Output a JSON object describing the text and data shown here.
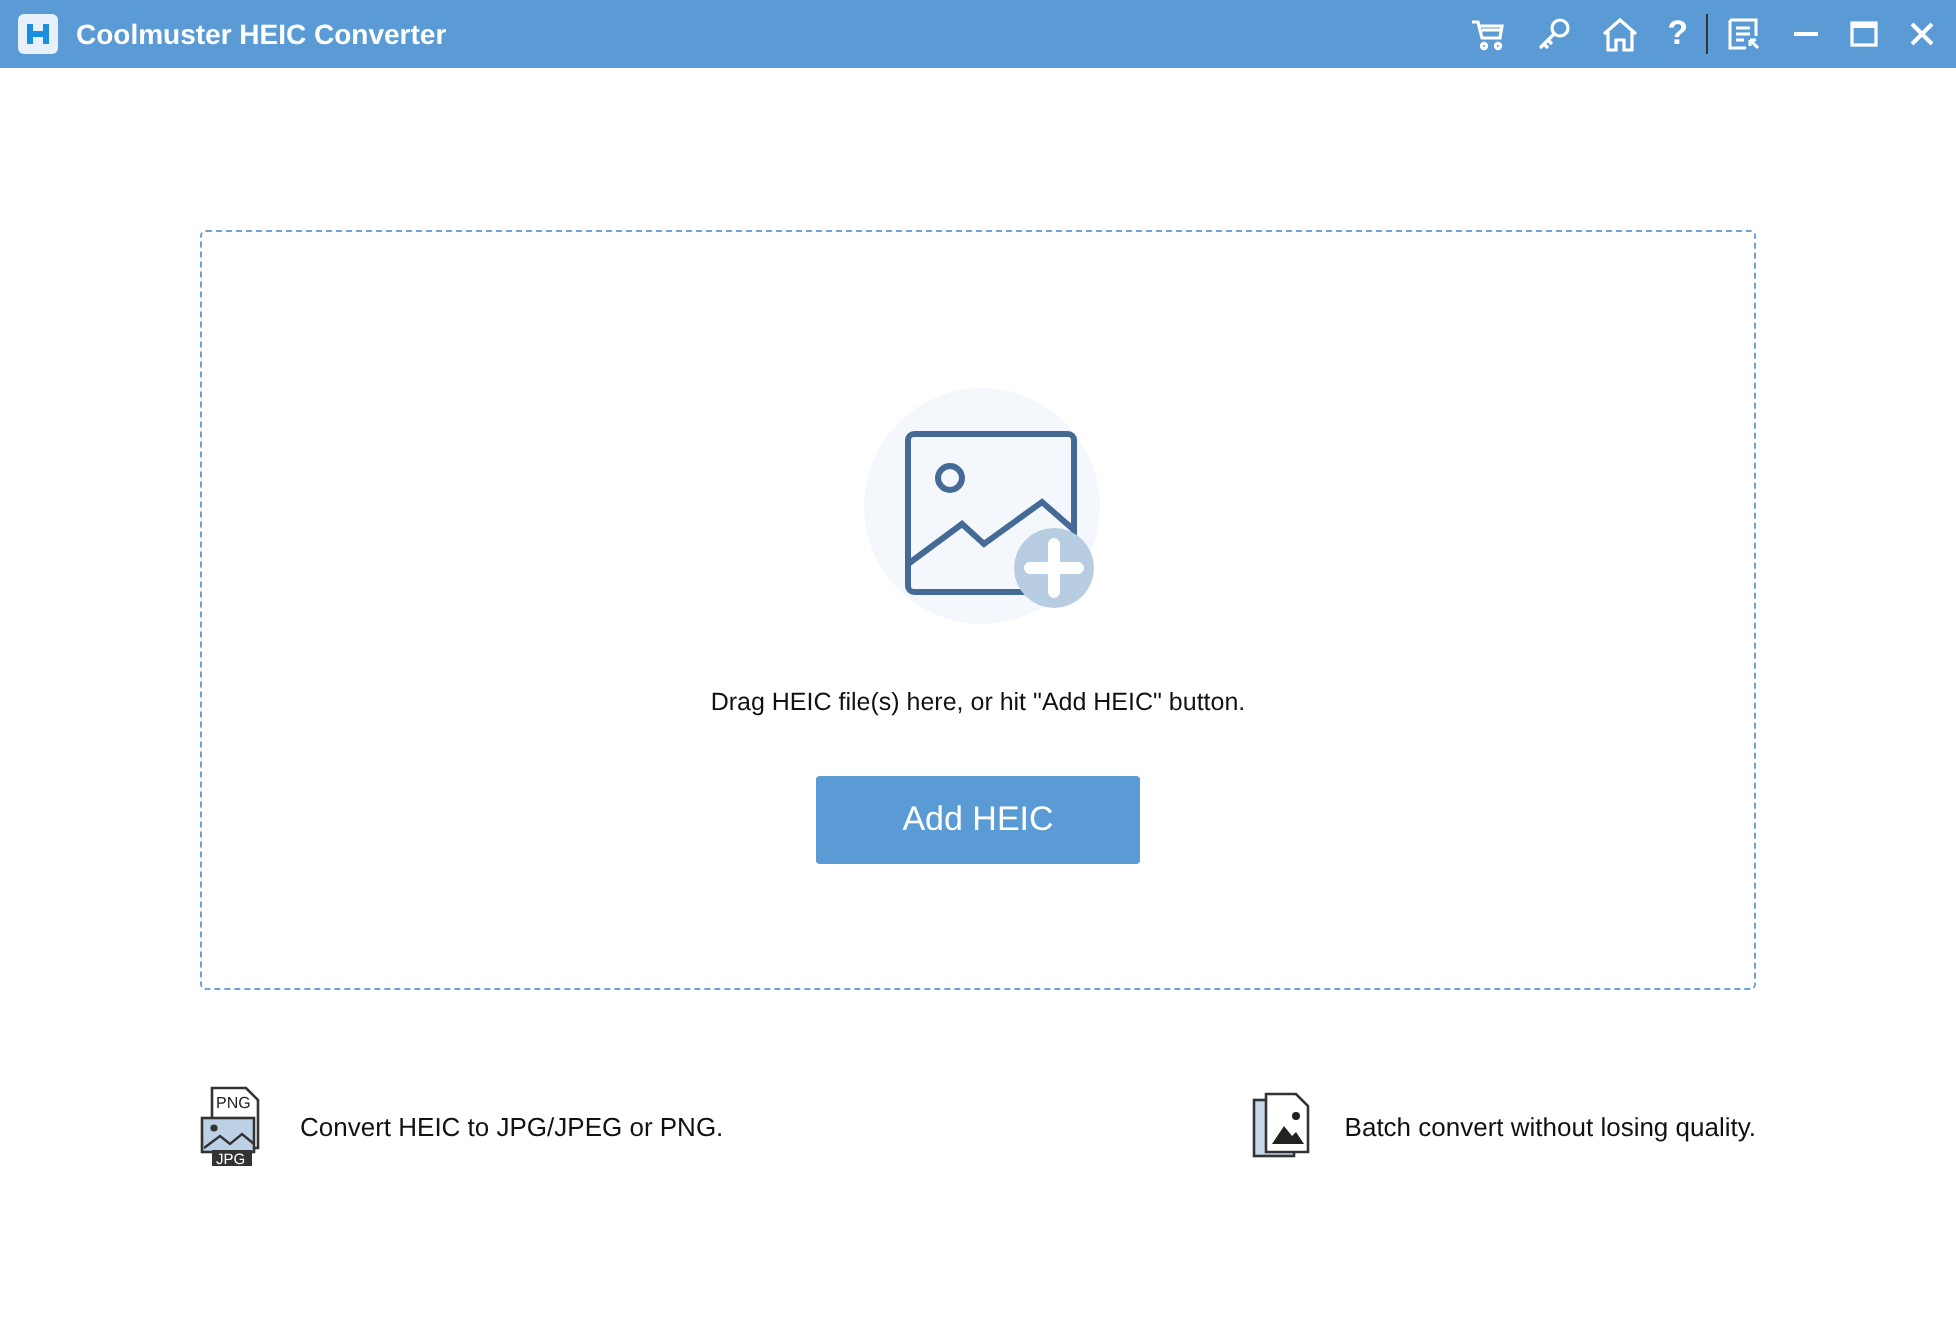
{
  "window": {
    "title": "Coolmuster HEIC Converter",
    "help_glyph": "?"
  },
  "drop_zone": {
    "hint": "Drag HEIC file(s) here, or hit \"Add HEIC\" button.",
    "button": "Add HEIC"
  },
  "features": [
    {
      "kind": "formats",
      "text": "Convert HEIC to JPG/JPEG or PNG.",
      "badge_top": "PNG",
      "badge_bottom": "JPG"
    },
    {
      "kind": "batch",
      "text": "Batch convert without losing quality."
    }
  ]
}
